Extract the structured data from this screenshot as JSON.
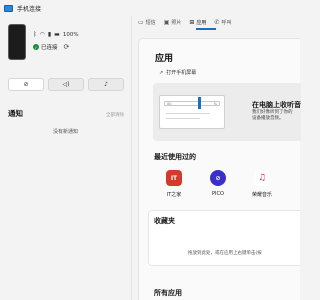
{
  "window": {
    "title": "手机连接"
  },
  "device": {
    "battery": "100%",
    "connection_status": "已连接",
    "status_icons": [
      "bluetooth-icon",
      "wifi-icon",
      "signal-icon",
      "battery-icon"
    ]
  },
  "quick_actions": [
    "focus-icon",
    "volume-icon",
    "music-icon"
  ],
  "notifications": {
    "title": "通知",
    "clear_all": "全部清除",
    "empty": "没有新通知"
  },
  "tabs": [
    {
      "label": "短信",
      "icon": "message-icon"
    },
    {
      "label": "照片",
      "icon": "photo-icon"
    },
    {
      "label": "应用",
      "icon": "apps-icon",
      "active": true
    },
    {
      "label": "呼叫",
      "icon": "phone-icon"
    }
  ],
  "apps": {
    "title": "应用",
    "open_screen": "打开手机屏幕",
    "promo": {
      "title": "在电脑上收听音",
      "desc_line1": "我们好像听到了你的",
      "desc_line2": "设备播放音频。",
      "mock_left": "00",
      "mock_right": "%"
    },
    "recent_title": "最近使用过的",
    "recent": [
      {
        "label": "IT之家",
        "color": "#d43a2c",
        "glyph": "IT"
      },
      {
        "label": "PICO",
        "color": "#3a2fc9",
        "glyph": "⊘"
      },
      {
        "label": "荣耀音乐",
        "color": "#ffffff",
        "glyph": "♫"
      }
    ],
    "favorites_title": "收藏夹",
    "favorites_hint": "拖放到此处，或在应用上右键单击(按",
    "all_title": "所有应用"
  },
  "colors": {
    "accent": "#1a6fc4",
    "connected": "#1f8b3a"
  }
}
